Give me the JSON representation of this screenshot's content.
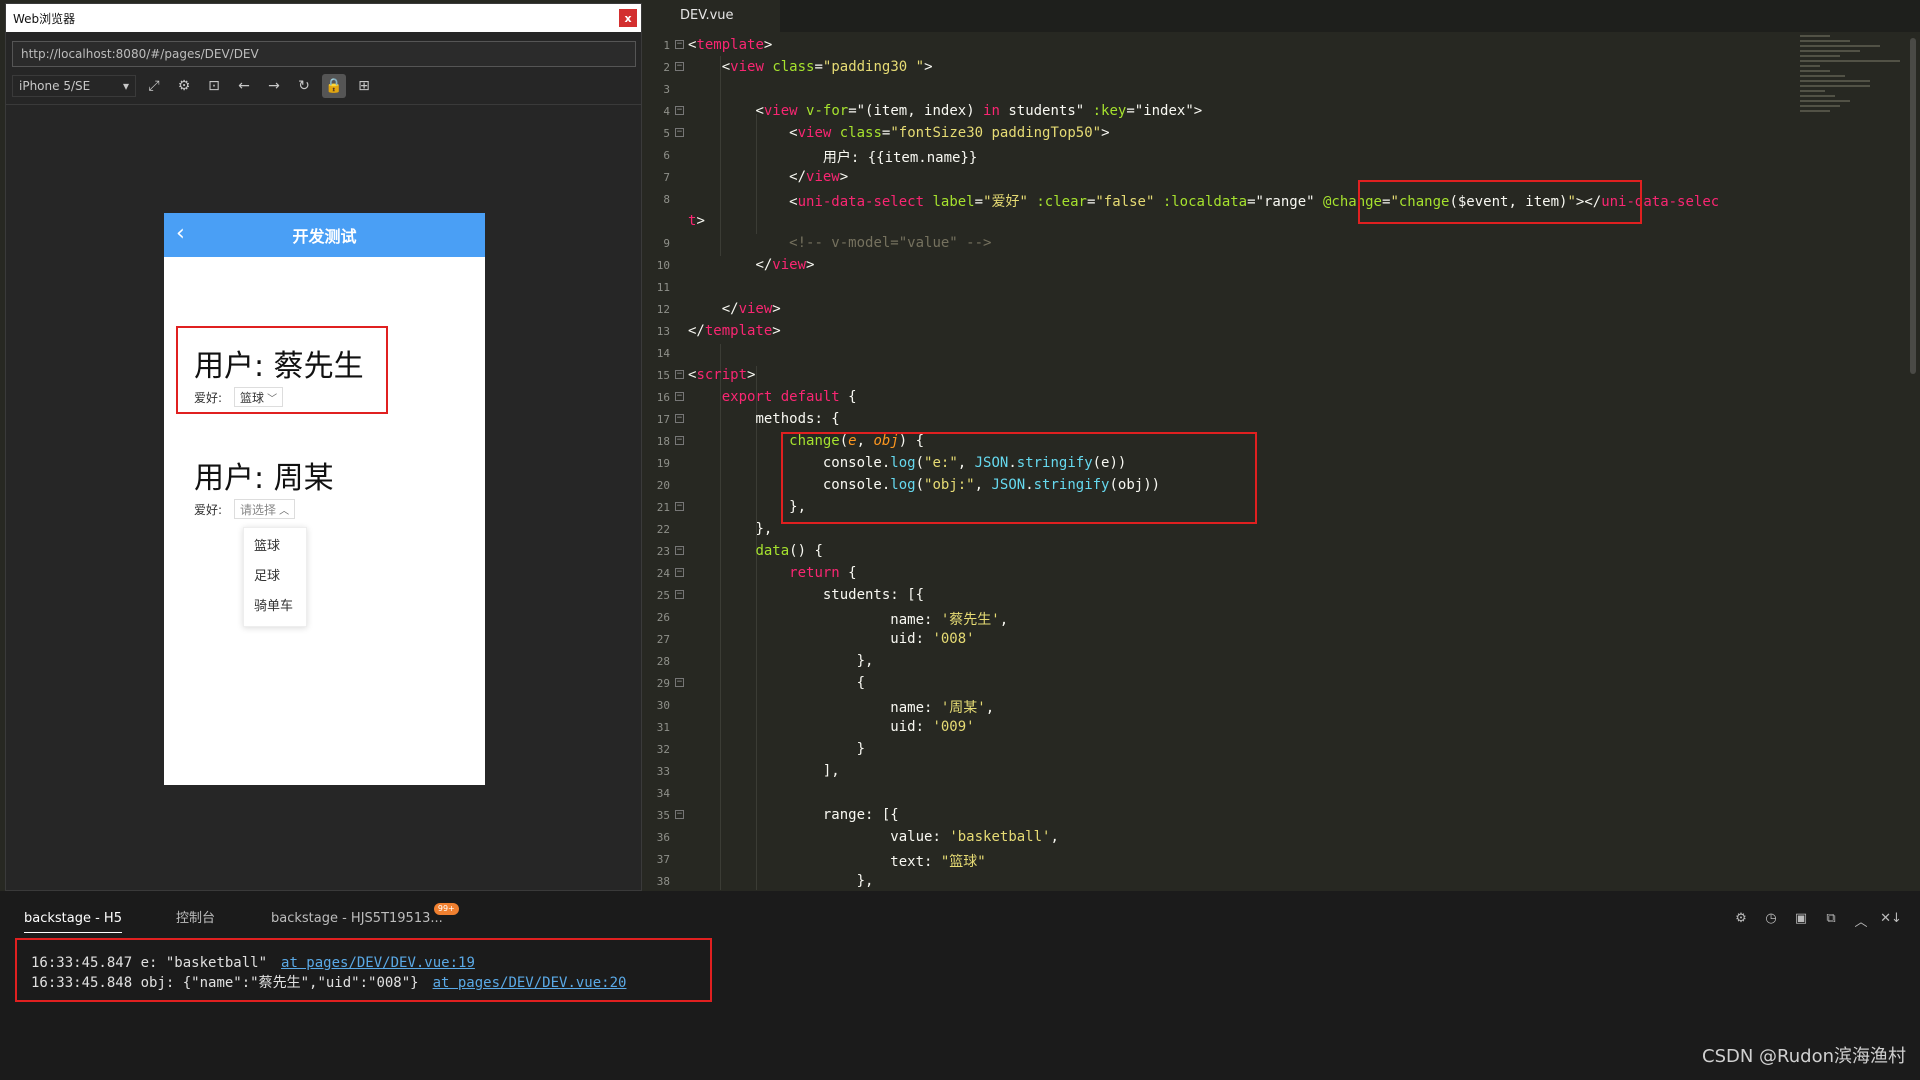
{
  "browser": {
    "title": "Web浏览器",
    "close_label": "x",
    "url": "http://localhost:8080/#/pages/DEV/DEV",
    "device": "iPhone 5/SE",
    "device_caret": "▾",
    "toolbar_icons": [
      "rotate-icon",
      "settings-icon",
      "console-icon",
      "back-arrow-icon",
      "forward-arrow-icon",
      "refresh-icon",
      "lock-icon",
      "grid-icon"
    ],
    "toolbar_glyphs": [
      "⤢",
      "⚙",
      "⊡",
      "←",
      "→",
      "↻",
      "🔒",
      "⊞"
    ]
  },
  "phone": {
    "back_glyph": "‹",
    "nav_title": "开发测试",
    "users": [
      {
        "name": "用户: 蔡先生",
        "hobby_label": "爱好:",
        "selected": "篮球",
        "chevron": "﹀"
      },
      {
        "name": "用户: 周某",
        "hobby_label": "爱好:",
        "placeholder": "请选择",
        "chevron": "︿"
      }
    ],
    "dropdown": [
      "篮球",
      "足球",
      "骑单车"
    ]
  },
  "editor": {
    "tab": "DEV.vue",
    "lines": [
      {
        "n": "1",
        "fold": "⊟",
        "html": "<span class='pn'>&lt;</span><span class='tg'>template</span><span class='pn'>&gt;</span>"
      },
      {
        "n": "2",
        "fold": "⊟",
        "html": "    <span class='pn'>&lt;</span><span class='tg'>view</span> <span class='at'>class</span><span class='pn'>=</span><span class='st'>\"padding30 \"</span><span class='pn'>&gt;</span>"
      },
      {
        "n": "3",
        "fold": "",
        "html": ""
      },
      {
        "n": "4",
        "fold": "⊟",
        "html": "        <span class='pn'>&lt;</span><span class='tg'>view</span> <span class='at'>v-for</span><span class='pn'>=\"(item, index) </span><span class='kw'>in</span><span class='pn'> students\" </span><span class='at'>:key</span><span class='pn'>=\"index\"&gt;</span>"
      },
      {
        "n": "5",
        "fold": "⊟",
        "html": "            <span class='pn'>&lt;</span><span class='tg'>view</span> <span class='at'>class</span><span class='pn'>=</span><span class='st'>\"fontSize30 paddingTop50\"</span><span class='pn'>&gt;</span>"
      },
      {
        "n": "6",
        "fold": "",
        "html": "                <span class='pn'>用户: {{item.name}}</span>"
      },
      {
        "n": "7",
        "fold": "",
        "html": "            <span class='pn'>&lt;/</span><span class='tg'>view</span><span class='pn'>&gt;</span>"
      },
      {
        "n": "8",
        "fold": "",
        "html": "            <span class='pn'>&lt;</span><span class='tg'>uni-data-select</span> <span class='at'>label</span><span class='pn'>=</span><span class='st'>\"爱好\"</span> <span class='at'>:clear</span><span class='pn'>=</span><span class='st'>\"false\"</span> <span class='at'>:localdata</span><span class='pn'>=\"range\" </span><span class='at'>@change</span><span class='pn'>=</span><span class='st'>\"</span><span class='fn'>change</span><span class='pn'>($event, item)</span><span class='st'>\"</span><span class='pn'>&gt;&lt;/</span><span class='tg'>uni-data-selec</span>"
      },
      {
        "n": "",
        "fold": "",
        "html": "<span class='tg'>t</span><span class='pn'>&gt;</span>"
      },
      {
        "n": "9",
        "fold": "",
        "html": "            <span class='cm'>&lt;!-- v-model=\"value\" --&gt;</span>"
      },
      {
        "n": "10",
        "fold": "",
        "html": "        <span class='pn'>&lt;/</span><span class='tg'>view</span><span class='pn'>&gt;</span>"
      },
      {
        "n": "11",
        "fold": "",
        "html": ""
      },
      {
        "n": "12",
        "fold": "",
        "html": "    <span class='pn'>&lt;/</span><span class='tg'>view</span><span class='pn'>&gt;</span>"
      },
      {
        "n": "13",
        "fold": "",
        "html": "<span class='pn'>&lt;/</span><span class='tg'>template</span><span class='pn'>&gt;</span>"
      },
      {
        "n": "14",
        "fold": "",
        "html": ""
      },
      {
        "n": "15",
        "fold": "⊟",
        "html": "<span class='pn'>&lt;</span><span class='tg'>script</span><span class='pn'>&gt;</span>"
      },
      {
        "n": "16",
        "fold": "⊟",
        "html": "    <span class='kw'>export default</span><span class='pn'> {</span>"
      },
      {
        "n": "17",
        "fold": "⊟",
        "html": "        <span class='pn'>methods: {</span>"
      },
      {
        "n": "18",
        "fold": "⊟",
        "html": "            <span class='fn'>change</span><span class='pn'>(</span><span class='pm'>e</span><span class='pn'>, </span><span class='pm'>obj</span><span class='pn'>) {</span>"
      },
      {
        "n": "19",
        "fold": "",
        "html": "                <span class='pn'>console.</span><span class='bl'>log</span><span class='pn'>(</span><span class='st'>\"e:\"</span><span class='pn'>, </span><span class='bl'>JSON</span><span class='pn'>.</span><span class='bl'>stringify</span><span class='pn'>(e))</span>"
      },
      {
        "n": "20",
        "fold": "",
        "html": "                <span class='pn'>console.</span><span class='bl'>log</span><span class='pn'>(</span><span class='st'>\"obj:\"</span><span class='pn'>, </span><span class='bl'>JSON</span><span class='pn'>.</span><span class='bl'>stringify</span><span class='pn'>(obj))</span>"
      },
      {
        "n": "21",
        "fold": "⊟",
        "html": "            <span class='pn'>},</span>"
      },
      {
        "n": "22",
        "fold": "",
        "html": "        <span class='pn'>},</span>"
      },
      {
        "n": "23",
        "fold": "⊟",
        "html": "        <span class='fn'>data</span><span class='pn'>() {</span>"
      },
      {
        "n": "24",
        "fold": "⊟",
        "html": "            <span class='kw'>return</span><span class='pn'> {</span>"
      },
      {
        "n": "25",
        "fold": "⊟",
        "html": "                <span class='pn'>students: [{</span>"
      },
      {
        "n": "26",
        "fold": "",
        "html": "                        <span class='pn'>name: </span><span class='st'>'蔡先生'</span><span class='pn'>,</span>"
      },
      {
        "n": "27",
        "fold": "",
        "html": "                        <span class='pn'>uid: </span><span class='st'>'008'</span>"
      },
      {
        "n": "28",
        "fold": "",
        "html": "                    <span class='pn'>},</span>"
      },
      {
        "n": "29",
        "fold": "⊟",
        "html": "                    <span class='pn'>{</span>"
      },
      {
        "n": "30",
        "fold": "",
        "html": "                        <span class='pn'>name: </span><span class='st'>'周某'</span><span class='pn'>,</span>"
      },
      {
        "n": "31",
        "fold": "",
        "html": "                        <span class='pn'>uid: </span><span class='st'>'009'</span>"
      },
      {
        "n": "32",
        "fold": "",
        "html": "                    <span class='pn'>}</span>"
      },
      {
        "n": "33",
        "fold": "",
        "html": "                <span class='pn'>],</span>"
      },
      {
        "n": "34",
        "fold": "",
        "html": ""
      },
      {
        "n": "35",
        "fold": "⊟",
        "html": "                <span class='pn'>range: [{</span>"
      },
      {
        "n": "36",
        "fold": "",
        "html": "                        <span class='pn'>value: </span><span class='st'>'basketball'</span><span class='pn'>,</span>"
      },
      {
        "n": "37",
        "fold": "",
        "html": "                        <span class='pn'>text: </span><span class='st'>\"篮球\"</span>"
      },
      {
        "n": "38",
        "fold": "",
        "html": "                    <span class='pn'>},</span>"
      }
    ]
  },
  "console": {
    "tabs": [
      "backstage - H5",
      "控制台",
      "backstage - HJS5T19513..."
    ],
    "badge": "99+",
    "action_glyphs": [
      "⚙",
      "◷",
      "▣",
      "⧉",
      "︿",
      "✕↓"
    ],
    "logs": [
      {
        "time": "16:33:45.847",
        "text": " e: \"basketball\"",
        "link": "at pages/DEV/DEV.vue:19"
      },
      {
        "time": "16:33:45.848",
        "text": " obj: {\"name\":\"蔡先生\",\"uid\":\"008\"}",
        "link": "at pages/DEV/DEV.vue:20"
      }
    ]
  },
  "watermark": "CSDN @Rudon滨海渔村",
  "colors": {
    "accent_blue": "#4a9ff5",
    "highlight_red": "#e02020",
    "editor_bg": "#272822"
  }
}
